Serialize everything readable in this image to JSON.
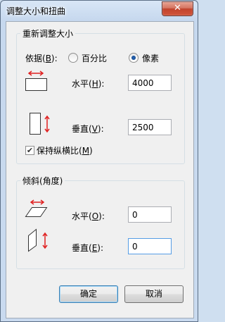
{
  "window": {
    "title": "调整大小和扭曲",
    "close": "✕"
  },
  "resize": {
    "title": "重新调整大小",
    "by_label": "依据(B):",
    "options": [
      {
        "label": "百分比",
        "selected": false
      },
      {
        "label": "像素",
        "selected": true
      }
    ],
    "horizontal_label": "水平(H):",
    "horizontal_value": "4000",
    "vertical_label": "垂直(V):",
    "vertical_value": "2500",
    "keep_ratio_label": "保持纵横比(M)",
    "keep_ratio_checked": true
  },
  "skew": {
    "title": "倾斜(角度)",
    "horizontal_label": "水平(O):",
    "horizontal_value": "0",
    "vertical_label": "垂直(E):",
    "vertical_value": "0"
  },
  "buttons": {
    "ok": "确定",
    "cancel": "取消"
  },
  "colors": {
    "arrow": "#e02020",
    "accent": "#569de5"
  },
  "icons": [
    "close-icon",
    "horizontal-resize-icon",
    "vertical-resize-icon",
    "horizontal-skew-icon",
    "vertical-skew-icon",
    "checkmark-icon"
  ]
}
